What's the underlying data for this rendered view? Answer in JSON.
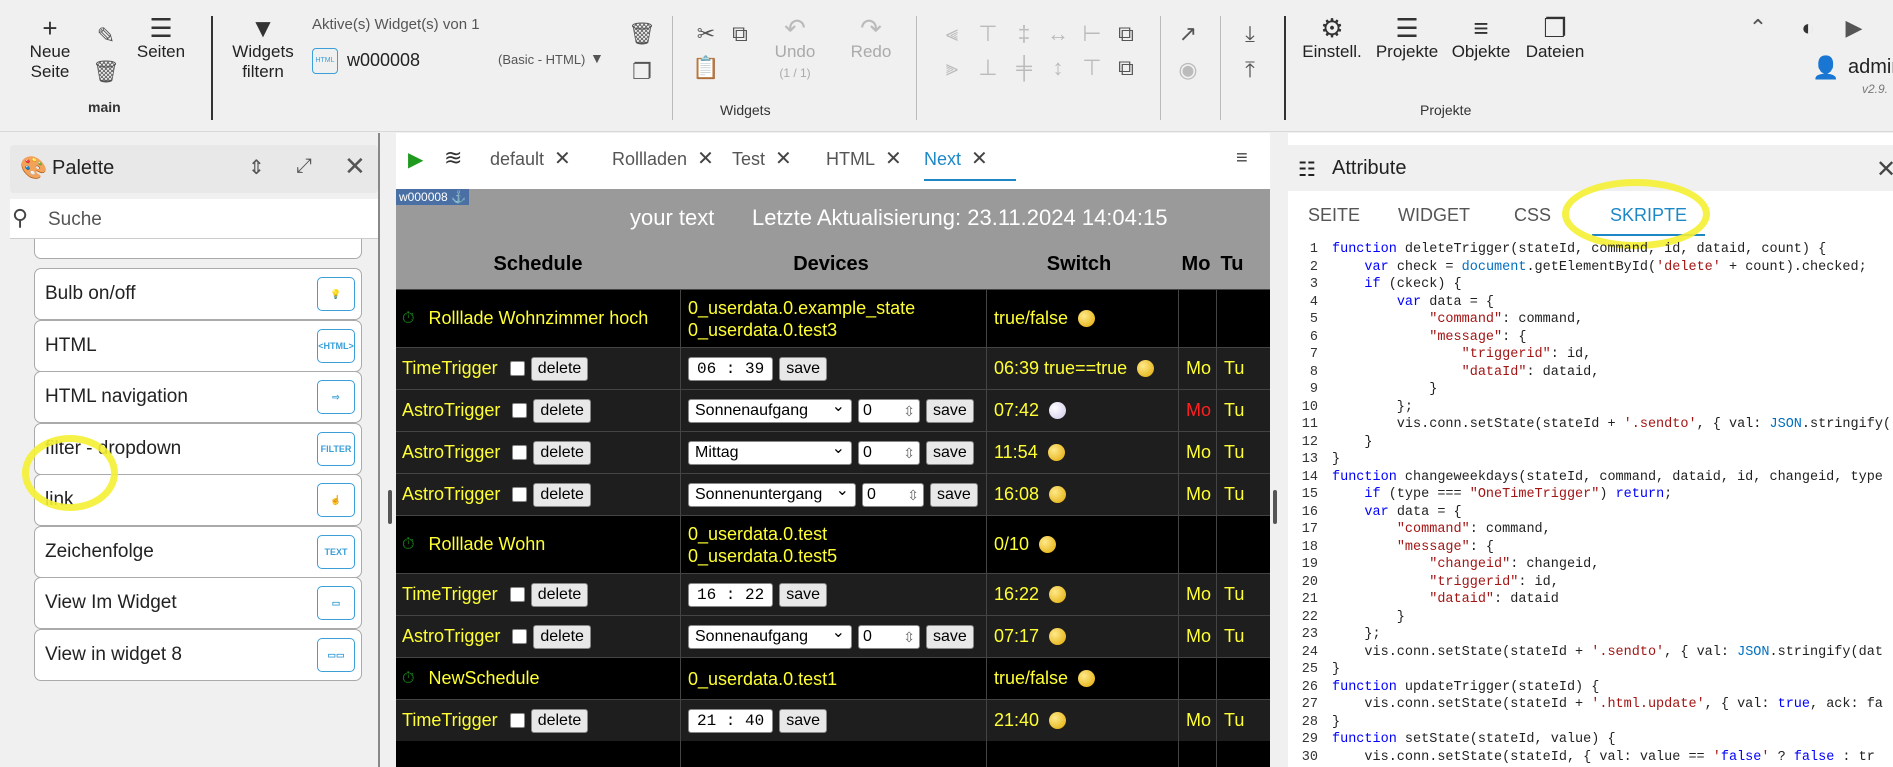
{
  "toolbar": {
    "neue_seite": "Neue Seite",
    "seiten": "Seiten",
    "main_label": "main",
    "widgets_filtern": "Widgets filtern",
    "active_widgets": "Aktive(s) Widget(s) von 1",
    "widget_id": "w000008",
    "widget_type": "(Basic - HTML)",
    "undo": "Undo",
    "undo_count": "(1 / 1)",
    "redo": "Redo",
    "widgets_label": "Widgets",
    "einstell": "Einstell.",
    "projekte": "Projekte",
    "objekte": "Objekte",
    "dateien": "Dateien",
    "projekte_label": "Projekte",
    "user": "admin",
    "version": "v2.9.",
    "widget_badge": "w000008 ⚓"
  },
  "palette": {
    "title": "Palette",
    "search_placeholder": "Suche",
    "items": [
      {
        "label": "Bulb on/off",
        "icon": "bulb-icon"
      },
      {
        "label": "HTML",
        "icon": "html-icon"
      },
      {
        "label": "HTML navigation",
        "icon": "html-nav-icon"
      },
      {
        "label": "filter - dropdown",
        "icon": "filter-icon"
      },
      {
        "label": "link",
        "icon": "link-icon"
      },
      {
        "label": "Zeichenfolge",
        "icon": "text-icon"
      },
      {
        "label": "View Im Widget",
        "icon": "view-icon"
      },
      {
        "label": "View in widget 8",
        "icon": "view8-icon"
      }
    ]
  },
  "tabs": [
    "default",
    "Rollladen",
    "Test",
    "HTML",
    "Next"
  ],
  "active_tab": "Next",
  "schedule": {
    "banner_text": "your text",
    "last_update": "Letzte Aktualisierung: 23.11.2024 14:04:15",
    "headers": {
      "schedule": "Schedule",
      "devices": "Devices",
      "switch": "Switch",
      "mo": "Mo",
      "tu": "Tu"
    },
    "delete_label": "delete",
    "save_label": "save",
    "rows": [
      {
        "kind": "group",
        "name": "Rolllade Wohnzimmer hoch",
        "devices": [
          "0_userdata.0.example_state",
          "0_userdata.0.test3"
        ],
        "switch": "true/false"
      },
      {
        "kind": "time",
        "name": "TimeTrigger",
        "time": "06 : 39",
        "switch": "06:39  true==true",
        "mo": "Mo",
        "tu": "Tu"
      },
      {
        "kind": "astro",
        "name": "AstroTrigger",
        "select": "Sonnenaufgang",
        "offset": "0",
        "switch": "07:42",
        "moon": true,
        "mo": "Mo",
        "tu": "Tu",
        "mo_red": true
      },
      {
        "kind": "astro",
        "name": "AstroTrigger",
        "select": "Mittag",
        "offset": "0",
        "switch": "11:54",
        "mo": "Mo",
        "tu": "Tu"
      },
      {
        "kind": "astro",
        "name": "AstroTrigger",
        "select": "Sonnenuntergang",
        "offset": "0",
        "switch": "16:08",
        "mo": "Mo",
        "tu": "Tu"
      },
      {
        "kind": "group",
        "name": "Rolllade Wohn",
        "devices": [
          "0_userdata.0.test",
          "0_userdata.0.test5"
        ],
        "switch": "0/10"
      },
      {
        "kind": "time",
        "name": "TimeTrigger",
        "time": "16 : 22",
        "switch": "16:22",
        "mo": "Mo",
        "tu": "Tu"
      },
      {
        "kind": "astro",
        "name": "AstroTrigger",
        "select": "Sonnenaufgang",
        "offset": "0",
        "switch": "07:17",
        "mo": "Mo",
        "tu": "Tu"
      },
      {
        "kind": "group",
        "name": "NewSchedule",
        "devices": [
          "0_userdata.0.test1"
        ],
        "switch": "true/false"
      },
      {
        "kind": "time",
        "name": "TimeTrigger",
        "time": "21 : 40",
        "switch": "21:40",
        "mo": "Mo",
        "tu": "Tu"
      }
    ]
  },
  "attributes": {
    "title": "Attribute",
    "tabs": [
      "SEITE",
      "WIDGET",
      "CSS",
      "SKRIPTE"
    ],
    "active_tab": "SKRIPTE",
    "code_lines": [
      "function deleteTrigger(stateId, command, id, dataid, count) {",
      "    var check = document.getElementById('delete' + count).checked;",
      "    if (ckeck) {",
      "        var data = {",
      "            \"command\": command,",
      "            \"message\": {",
      "                \"triggerid\": id,",
      "                \"dataId\": dataid,",
      "            }",
      "        };",
      "        vis.conn.setState(stateId + '.sendto', { val: JSON.stringify(",
      "    }",
      "}",
      "function changeweekdays(stateId, command, dataid, id, changeid, type",
      "    if (type === \"OneTimeTrigger\") return;",
      "    var data = {",
      "        \"command\": command,",
      "        \"message\": {",
      "            \"changeid\": changeid,",
      "            \"triggerid\": id,",
      "            \"dataid\": dataid",
      "        }",
      "    };",
      "    vis.conn.setState(stateId + '.sendto', { val: JSON.stringify(dat",
      "}",
      "function updateTrigger(stateId) {",
      "    vis.conn.setState(stateId + '.html.update', { val: true, ack: fa",
      "}",
      "function setState(stateId, value) {",
      "    vis.conn.setState(stateId, { val: value == 'false' ? false : tr"
    ]
  },
  "colors": {
    "accent": "#1e88c7",
    "schedule_text": "#ffff33",
    "highlight": "#f5f032"
  }
}
